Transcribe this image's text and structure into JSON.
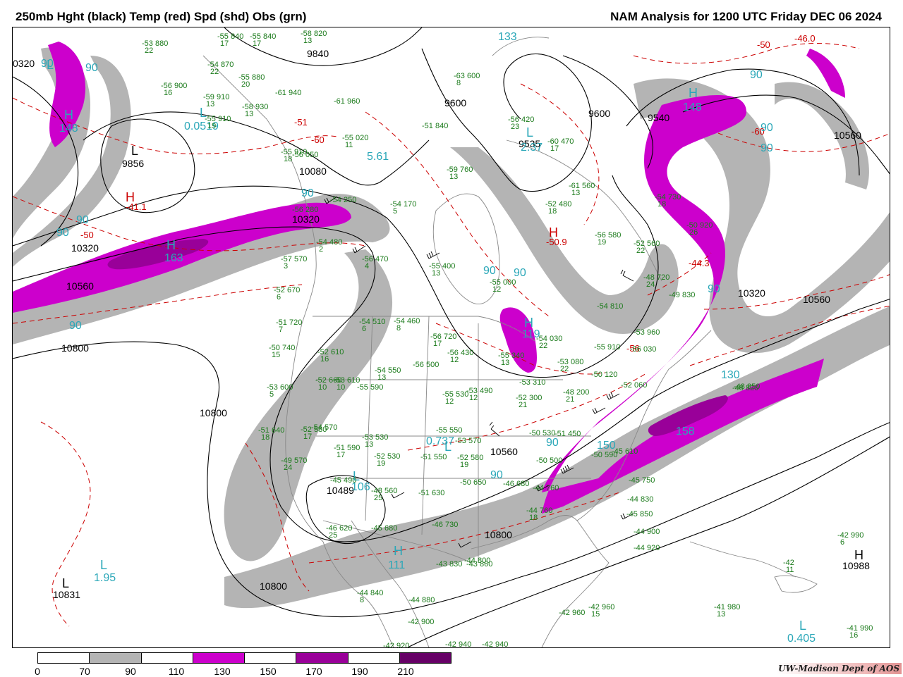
{
  "header": {
    "title_left": "250mb Hght (black) Temp (red) Spd (shd) Obs (grn)",
    "title_right": "NAM Analysis for 1200 UTC Friday  DEC 06 2024"
  },
  "colors": {
    "height_contour": "#000000",
    "temperature_contour": "#cc0000",
    "speed_label": "#2aa7b8",
    "observation": "#1a7a1a",
    "coast": "#888888"
  },
  "legend": {
    "ticks": [
      "0",
      "70",
      "90",
      "110",
      "130",
      "150",
      "170",
      "190",
      "210"
    ],
    "fills": [
      "#ffffff",
      "#b4b4b4",
      "#ffffff",
      "#cc00cc",
      "#ffffff",
      "#990099",
      "#ffffff",
      "#660066"
    ]
  },
  "credit": "UW-Madison  Dept of AOS",
  "height_labels": [
    "0320",
    "9840",
    "9600",
    "9600",
    "9535",
    "9540",
    "10560",
    "9856",
    "10080",
    "10320",
    "10320",
    "10560",
    "10800",
    "10800",
    "10560",
    "10320",
    "10560",
    "10560",
    "10800",
    "10800",
    "10831",
    "10988",
    "10489"
  ],
  "temp_labels": [
    "-50",
    "-46.0",
    "-60",
    "-60",
    "-51",
    "-41.1",
    "-50.9",
    "-44.3",
    "-56",
    "-50"
  ],
  "speed_labels": [
    "90",
    "90",
    "133",
    "90",
    "148",
    "148",
    "0.0519",
    "90",
    "90",
    "90",
    "163",
    "5.61",
    "2.37",
    "90",
    "90",
    "90",
    "119",
    "90",
    "90",
    "0.737",
    "90",
    "150",
    "130",
    "158",
    "90",
    "111",
    "1.95",
    "0.405",
    "90",
    "106"
  ],
  "pressure_symbols": [
    "L",
    "L",
    "H",
    "L",
    "H",
    "H",
    "H",
    "H",
    "L",
    "H",
    "L",
    "L",
    "H",
    "L",
    "L",
    "L",
    "H",
    "L"
  ],
  "observations": [
    [
      "-53",
      "22",
      "880"
    ],
    [
      "-55",
      "17",
      "840"
    ],
    [
      "-55",
      "17",
      "840"
    ],
    [
      "-58",
      "13",
      "820"
    ],
    [
      "-54",
      "22",
      "870"
    ],
    [
      "-55",
      "20",
      "880"
    ],
    [
      "-56",
      "16",
      "900"
    ],
    [
      "-59",
      "13",
      "910"
    ],
    [
      "-61",
      "",
      "940"
    ],
    [
      "-58",
      "13",
      "930"
    ],
    [
      "-55",
      "19",
      "910"
    ],
    [
      "-61",
      "",
      "960"
    ],
    [
      "-55",
      "11",
      "020"
    ],
    [
      "-51",
      "",
      "840"
    ],
    [
      "-55",
      "18",
      "910"
    ],
    [
      "-56",
      "",
      "050"
    ],
    [
      "-56",
      "",
      "280"
    ],
    [
      "-54",
      "5",
      "170"
    ],
    [
      "-54",
      "",
      "250"
    ],
    [
      "-54",
      "2",
      "480"
    ],
    [
      "-56",
      "4",
      "470"
    ],
    [
      "-57",
      "3",
      "570"
    ],
    [
      "-59",
      "13",
      "760"
    ],
    [
      "-63",
      "8",
      "600"
    ],
    [
      "-56",
      "23",
      "420"
    ],
    [
      "-60",
      "17",
      "470"
    ],
    [
      "-61",
      "13",
      "560"
    ],
    [
      "-52",
      "18",
      "480"
    ],
    [
      "-54",
      "18",
      "730"
    ],
    [
      "-56",
      "19",
      "580"
    ],
    [
      "-52",
      "22",
      "560"
    ],
    [
      "-50",
      "26",
      "920"
    ],
    [
      "-48",
      "24",
      "720"
    ],
    [
      "-49",
      "",
      "830"
    ],
    [
      "-55",
      "13",
      "400"
    ],
    [
      "-55",
      "12",
      "000"
    ],
    [
      "-54",
      "",
      "810"
    ],
    [
      "-52",
      "6",
      "670"
    ],
    [
      "-51",
      "7",
      "720"
    ],
    [
      "-50",
      "15",
      "740"
    ],
    [
      "-54",
      "6",
      "510"
    ],
    [
      "-54",
      "8",
      "460"
    ],
    [
      "-56",
      "17",
      "720"
    ],
    [
      "-56",
      "12",
      "430"
    ],
    [
      "-55",
      "13",
      "340"
    ],
    [
      "-52",
      "16",
      "610"
    ],
    [
      "-54",
      "13",
      "550"
    ],
    [
      "-56",
      "",
      "500"
    ],
    [
      "-53",
      "5",
      "600"
    ],
    [
      "-52",
      "10",
      "660"
    ],
    [
      "-53",
      "10",
      "610"
    ],
    [
      "-55",
      "",
      "590"
    ],
    [
      "-55",
      "12",
      "530"
    ],
    [
      "-53",
      "12",
      "490"
    ],
    [
      "-54",
      "22",
      "030"
    ],
    [
      "-53",
      "22",
      "080"
    ],
    [
      "-55",
      "",
      "910"
    ],
    [
      "-56",
      "",
      "030"
    ],
    [
      "-50",
      "",
      "120"
    ],
    [
      "-52",
      "",
      "060"
    ],
    [
      "-52",
      "21",
      "300"
    ],
    [
      "-53",
      "",
      "310"
    ],
    [
      "-48",
      "21",
      "200"
    ],
    [
      "-53",
      "",
      "960"
    ],
    [
      "-48",
      "",
      "850"
    ],
    [
      "-51",
      "18",
      "640"
    ],
    [
      "-52",
      "17",
      "580"
    ],
    [
      "-54",
      "",
      "570"
    ],
    [
      "-53",
      "13",
      "530"
    ],
    [
      "-55",
      "",
      "550"
    ],
    [
      "-53",
      "",
      "570"
    ],
    [
      "-50",
      "",
      "530"
    ],
    [
      "-49",
      "24",
      "570"
    ],
    [
      "-51",
      "17",
      "590"
    ],
    [
      "-52",
      "19",
      "530"
    ],
    [
      "-51",
      "",
      "550"
    ],
    [
      "-52",
      "19",
      "580"
    ],
    [
      "-51",
      "",
      "450"
    ],
    [
      "-50",
      "",
      "500"
    ],
    [
      "-45",
      "",
      "490"
    ],
    [
      "-48",
      "25",
      "560"
    ],
    [
      "-51",
      "",
      "630"
    ],
    [
      "-50",
      "",
      "650"
    ],
    [
      "-46",
      "",
      "680"
    ],
    [
      "-50",
      "",
      "590"
    ],
    [
      "-45",
      "",
      "610"
    ],
    [
      "-45",
      "",
      "750"
    ],
    [
      "-44",
      "18",
      "760"
    ],
    [
      "-44",
      "",
      "760"
    ],
    [
      "-44",
      "",
      "830"
    ],
    [
      "-45",
      "",
      "850"
    ],
    [
      "-44",
      "",
      "900"
    ],
    [
      "-44",
      "",
      "920"
    ],
    [
      "-46",
      "25",
      "620"
    ],
    [
      "-45",
      "",
      "680"
    ],
    [
      "-46",
      "",
      "730"
    ],
    [
      "-44",
      "",
      "800"
    ],
    [
      "-43",
      "",
      "830"
    ],
    [
      "-43",
      "",
      "860"
    ],
    [
      "-44",
      "8",
      "840"
    ],
    [
      "-44",
      "",
      "880"
    ],
    [
      "-42",
      "",
      "900"
    ],
    [
      "-42",
      "",
      "920"
    ],
    [
      "-42",
      "",
      "940"
    ],
    [
      "-42",
      "",
      "940"
    ],
    [
      "-42",
      "",
      "960"
    ],
    [
      "-42",
      "15",
      "960"
    ],
    [
      "-41",
      "13",
      "980"
    ],
    [
      "-42",
      "6",
      "990"
    ],
    [
      "-42",
      "11",
      ""
    ],
    [
      "-41",
      "16",
      "990"
    ],
    [
      "-48",
      "",
      "820"
    ]
  ]
}
